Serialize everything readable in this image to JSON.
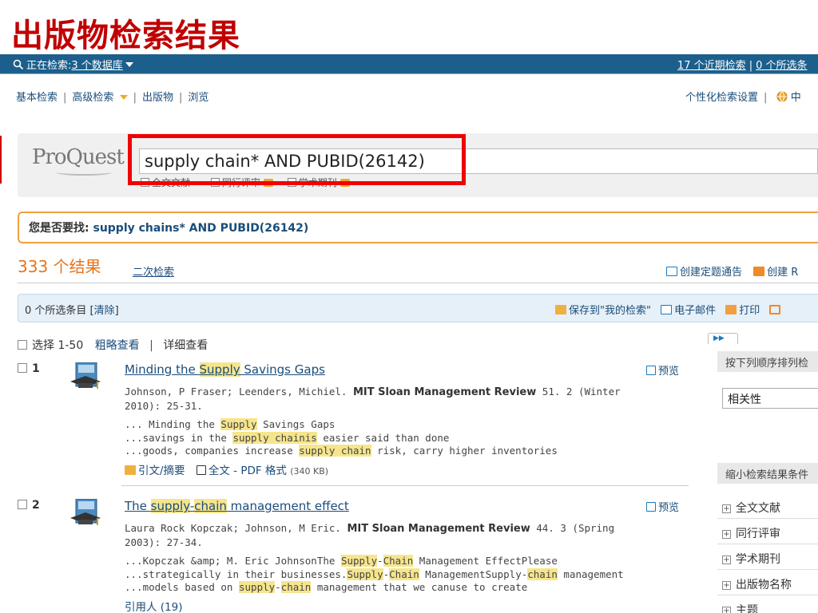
{
  "slide_title": "出版物检索结果",
  "topbar": {
    "searching_prefix": "正在检索: ",
    "databases_link": "3 个数据库",
    "recent_searches": "17 个近期检索",
    "separator": "|",
    "selected_items": "0 个所选条"
  },
  "nav": {
    "basic_search": "基本检索",
    "advanced_search": "高级检索",
    "publications": "出版物",
    "browse": "浏览",
    "personalize": "个性化检索设置",
    "language": "中"
  },
  "search": {
    "logo": "ProQuest",
    "query": "supply chain* AND PUBID(26142)",
    "filters": [
      "全文文献",
      "同行评审",
      "学术期刊"
    ]
  },
  "did_you_mean": {
    "prefix": "您是否要找: ",
    "suggestion": "supply chains* AND PUBID(26142)"
  },
  "results_header": {
    "count": "333 个结果",
    "refine": "二次检索",
    "create_alert": "创建定题通告",
    "create_rss": "创建 R"
  },
  "selection_bar": {
    "selected": "0 个所选条目 [",
    "clear": "清除",
    "close_bracket": "]",
    "save": "保存到\"我的检索\"",
    "email": "电子邮件",
    "print": "打印"
  },
  "list_header": {
    "select_range": "选择 1-50",
    "brief_view": "粗略查看",
    "pipe": "|",
    "detail_view": "详细查看"
  },
  "results": [
    {
      "num": "1",
      "title_parts": [
        "Minding the ",
        "Supply",
        " Savings Gaps"
      ],
      "preview": "预览",
      "cite_authors": "Johnson, P Fraser; Leenders, Michiel. ",
      "cite_journal": "MIT Sloan Management Review",
      "cite_rest": " 51. 2 (Winter 2010): 25-31.",
      "snippet_lines": [
        [
          "... Minding the ",
          "Supply",
          " Savings Gaps"
        ],
        [
          "...savings in the ",
          "supply chainis",
          " easier said than done"
        ],
        [
          "...goods, companies increase ",
          "supply chain",
          " risk, carry higher inventories"
        ]
      ],
      "link_abstract": "引文/摘要",
      "link_pdf": "全文 - PDF 格式",
      "pdf_size": "(340 KB)"
    },
    {
      "num": "2",
      "title_parts": [
        "The ",
        "supply",
        "-",
        "chain",
        " management effect"
      ],
      "preview": "预览",
      "cite_authors": "Laura Rock Kopczak; Johnson, M Eric. ",
      "cite_journal": "MIT Sloan Management Review",
      "cite_rest": " 44. 3 (Spring 2003): 27-34.",
      "snippet_lines": [
        [
          "...Kopczak &amp; M. Eric JohnsonThe ",
          "Supply",
          "-",
          "Chain",
          " Management EffectPlease"
        ],
        [
          "...strategically in their businesses.",
          "Supply",
          "-",
          "Chain",
          " ManagementSupply-",
          "chain",
          " management"
        ],
        [
          "...models based on ",
          "supply",
          "-",
          "chain",
          " management that we canuse to create"
        ]
      ],
      "cited_by": "引用人 (19)"
    }
  ],
  "sidebar": {
    "toggle": "▶▶",
    "sort_head": "按下列顺序排列检",
    "sort_value": "相关性",
    "narrow_head": "缩小检索结果条件",
    "facets": [
      "全文文献",
      "同行评审",
      "学术期刊",
      "出版物名称",
      "主题"
    ]
  },
  "colors": {
    "title_red": "#c00000",
    "topbar_blue": "#1c5f8c",
    "link_blue": "#1a4d7a",
    "highlight": "#f6e58d",
    "count_orange": "#e8731a",
    "annotation_red": "#f00000"
  }
}
